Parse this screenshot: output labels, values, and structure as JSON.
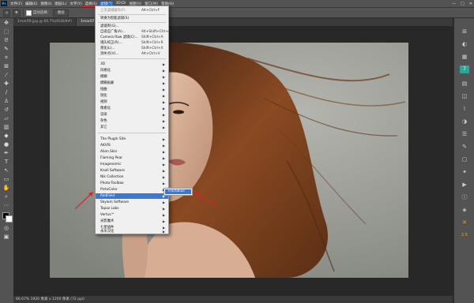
{
  "menubar": {
    "app_icon": "Ps",
    "items": [
      "文件(F)",
      "编辑(E)",
      "图像(I)",
      "图层(L)",
      "文字(Y)",
      "选择(S)",
      "滤镜(T)",
      "3D(D)",
      "视图(V)",
      "窗口(W)",
      "帮助(H)"
    ],
    "active_index": 6,
    "window_controls": [
      "—",
      "□",
      "✕"
    ]
  },
  "options": {
    "auto_select_label": "自动选择：",
    "layer_select": "图层"
  },
  "tabs": [
    {
      "label": "1mar09.jpg @ 66.7%(RGB/8#)"
    },
    {
      "label": "1mar07.jpg @"
    }
  ],
  "status": {
    "text": "66.67%    1920 像素 x 1200 像素 (72 ppi)"
  },
  "filter_menu": {
    "top_items": [
      {
        "label": "上次滤镜操作(F)",
        "shortcut": "Alt+Ctrl+F",
        "dim": true
      },
      {
        "label": "转换为智能滤镜(S)",
        "shortcut": ""
      },
      {
        "label": "滤镜库(G)...",
        "shortcut": ""
      },
      {
        "label": "自适应广角(A)...",
        "shortcut": "Alt+Shift+Ctrl+A"
      },
      {
        "label": "Camera Raw 滤镜(C)...",
        "shortcut": "Shift+Ctrl+A"
      },
      {
        "label": "镜头校正(R)...",
        "shortcut": "Shift+Ctrl+R"
      },
      {
        "label": "液化(L)...",
        "shortcut": "Shift+Ctrl+X"
      },
      {
        "label": "消失点(V)...",
        "shortcut": "Alt+Ctrl+V"
      }
    ],
    "groups": [
      "3D",
      "风格化",
      "模糊",
      "模糊画廊",
      "扭曲",
      "锐化",
      "视频",
      "像素化",
      "渲染",
      "杂色",
      "其它"
    ],
    "plugins": [
      "The Plugin Site",
      "AKVIS",
      "Alien Skin",
      "Flaming Pear",
      "Imagenomic",
      "Knoll Software",
      "Nik Collection",
      "Photo-Toolbox",
      "PictoColor",
      "RedField",
      "Skylum Software",
      "Topaz Labs",
      "Vertus™",
      "光影魔术",
      "七星插件",
      "永乐汉化"
    ],
    "highlighted": "RedField"
  },
  "submenu": {
    "item": "Fractalius"
  },
  "icons": {
    "move": "move-icon",
    "marquee": "marquee-icon",
    "lasso": "lasso-icon",
    "crop": "crop-icon",
    "brush": "brush-icon",
    "text": "text-icon",
    "zoom": "zoom-icon"
  },
  "colors": {
    "accent": "#3a78d7",
    "annotation": "#e02020"
  }
}
